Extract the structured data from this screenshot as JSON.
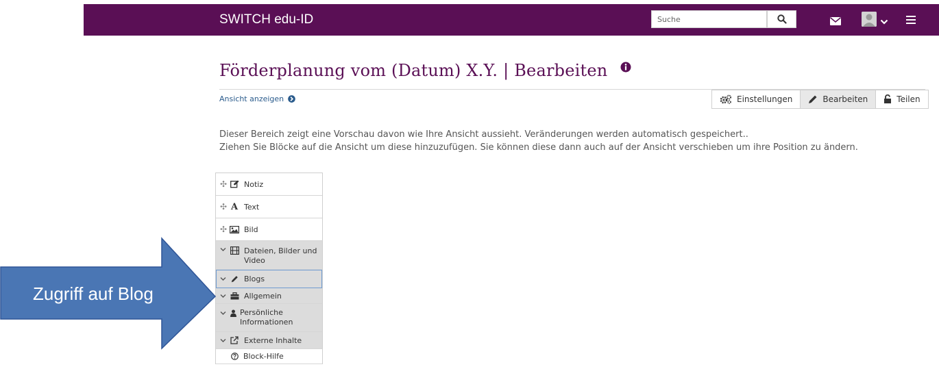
{
  "header": {
    "brand": "SWITCH edu-ID",
    "search_placeholder": "Suche",
    "colors": {
      "bar": "#5a0f55",
      "title": "#5a0f55",
      "link": "#2a5b8c",
      "arrow": "#4a76b4"
    }
  },
  "page": {
    "title": "Förderplanung vom (Datum) X.Y. | Bearbeiten",
    "view_link": "Ansicht anzeigen",
    "toolbar": {
      "settings": "Einstellungen",
      "edit": "Bearbeiten",
      "share": "Teilen"
    },
    "description": [
      "Dieser Bereich zeigt eine Vorschau davon wie Ihre Ansicht aussieht. Veränderungen werden automatisch gespeichert..",
      "Ziehen Sie Blöcke auf die Ansicht um diese hinzuzufügen. Sie können diese dann auch auf der Ansicht verschieben um ihre Position zu ändern."
    ]
  },
  "palette": {
    "items": [
      {
        "label": "Notiz",
        "icon": "note-edit-icon"
      },
      {
        "label": "Text",
        "icon": "text-icon"
      },
      {
        "label": "Bild",
        "icon": "image-icon"
      },
      {
        "label": "Dateien, Bilder und Video",
        "icon": "film-icon"
      },
      {
        "label": "Blogs",
        "icon": "pencil-icon"
      },
      {
        "label": "Allgemein",
        "icon": "briefcase-icon"
      },
      {
        "label": "Persönliche Informationen",
        "icon": "user-icon"
      },
      {
        "label": "Externe Inhalte",
        "icon": "external-link-icon"
      },
      {
        "label": "Block-Hilfe",
        "icon": "help-icon"
      }
    ]
  },
  "annotation": {
    "arrow_text": "Zugriff auf Blog"
  }
}
